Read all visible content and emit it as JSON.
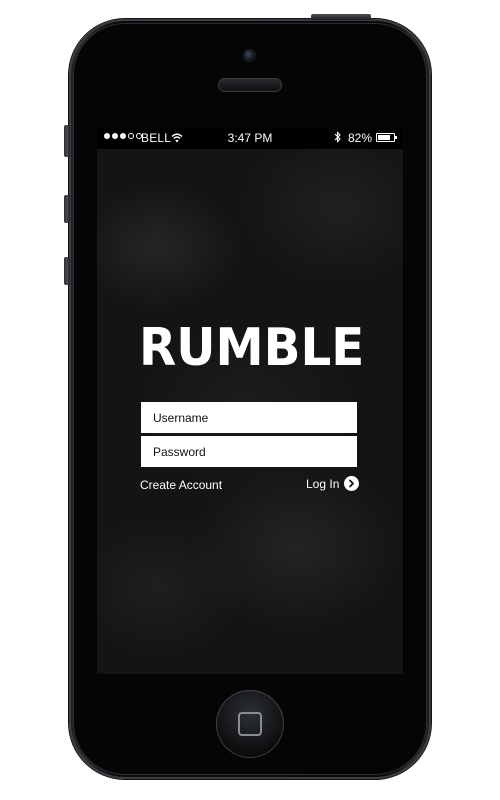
{
  "status_bar": {
    "signal_dots_filled": 3,
    "signal_dots_total": 5,
    "carrier": "BELL",
    "time": "3:47 PM",
    "battery_percent": "82%",
    "battery_level": 0.82,
    "icons": [
      "wifi-icon",
      "bluetooth-icon",
      "battery-icon"
    ]
  },
  "app": {
    "logo_text": "RUMBLE"
  },
  "login_form": {
    "username_placeholder": "Username",
    "password_placeholder": "Password",
    "create_account_label": "Create Account",
    "login_label": "Log In",
    "login_icon": "chevron-right-circle-icon"
  },
  "colors": {
    "screen_background": "#141414",
    "text": "#ffffff",
    "field_background": "#ffffff"
  }
}
